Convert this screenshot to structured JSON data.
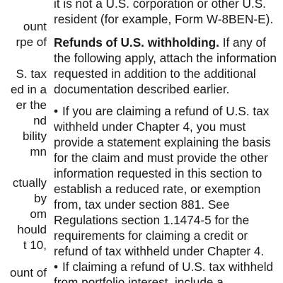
{
  "left_column": {
    "fragments": [
      "ount",
      "rpe of",
      "S. tax",
      "ed in a",
      "er the",
      "nd",
      "bility",
      "mn",
      "ctually",
      "by",
      "om",
      "hould",
      "t 10,",
      "ount of"
    ]
  },
  "right_column": {
    "intro_line_1": "it is not a U.S. corporation or other U.S.",
    "intro_line_2": "resident (for example, Form W-8BEN-E).",
    "heading": "Refunds of U.S. withholding.",
    "heading_text_1": " If any of",
    "para1_line_2": "the following apply, attach the information",
    "para1_line_3": "requested in addition to the additional",
    "para1_line_4": "documentation described earlier.",
    "bullet_char": "•",
    "bullet1_line_1": "If you are claiming a refund of U.S. tax",
    "bullet1_line_2": "withheld under Chapter 4, you must",
    "bullet1_line_3": "provide a statement explaining the basis",
    "bullet1_line_4": "for the claim and must provide the other",
    "bullet1_line_5": "information requested in this section to",
    "bullet1_line_6": "establish a reduced rate, or exemption",
    "bullet1_line_7": "from, tax under section 881. See",
    "bullet1_line_8": "Regulations section 1.1474-5 for the",
    "bullet1_line_9": "requirements for claiming a credit or",
    "bullet1_line_10": "refund of tax withheld under Chapter 4.",
    "bullet2_line_1": "If claiming a refund of U.S. tax withheld",
    "bullet2_line_2": "from portfolio interest, include a"
  }
}
